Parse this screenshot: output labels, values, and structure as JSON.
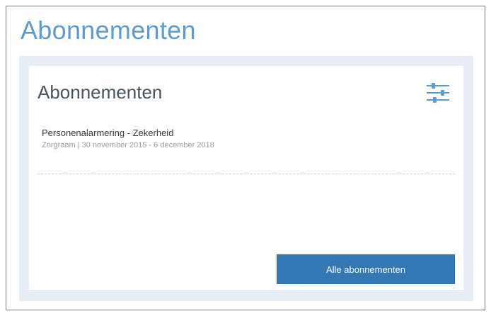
{
  "page": {
    "title": "Abonnementen"
  },
  "card": {
    "title": "Abonnementen",
    "filter_icon": "filter-sliders-icon",
    "subscriptions": [
      {
        "name": "Personenalarmering - Zekerheid",
        "provider": "Zorgraam",
        "period": "30 november 2015 - 6 december 2018",
        "meta": "Zorgraam | 30 november 2015 - 6 december 2018"
      }
    ],
    "all_button_label": "Alle abonnementen"
  },
  "colors": {
    "title_blue": "#5a9bd5",
    "panel_bg": "#e6edf4",
    "button_blue": "#3278b4",
    "card_title": "#46555f",
    "meta_gray": "#9aa0a6"
  }
}
